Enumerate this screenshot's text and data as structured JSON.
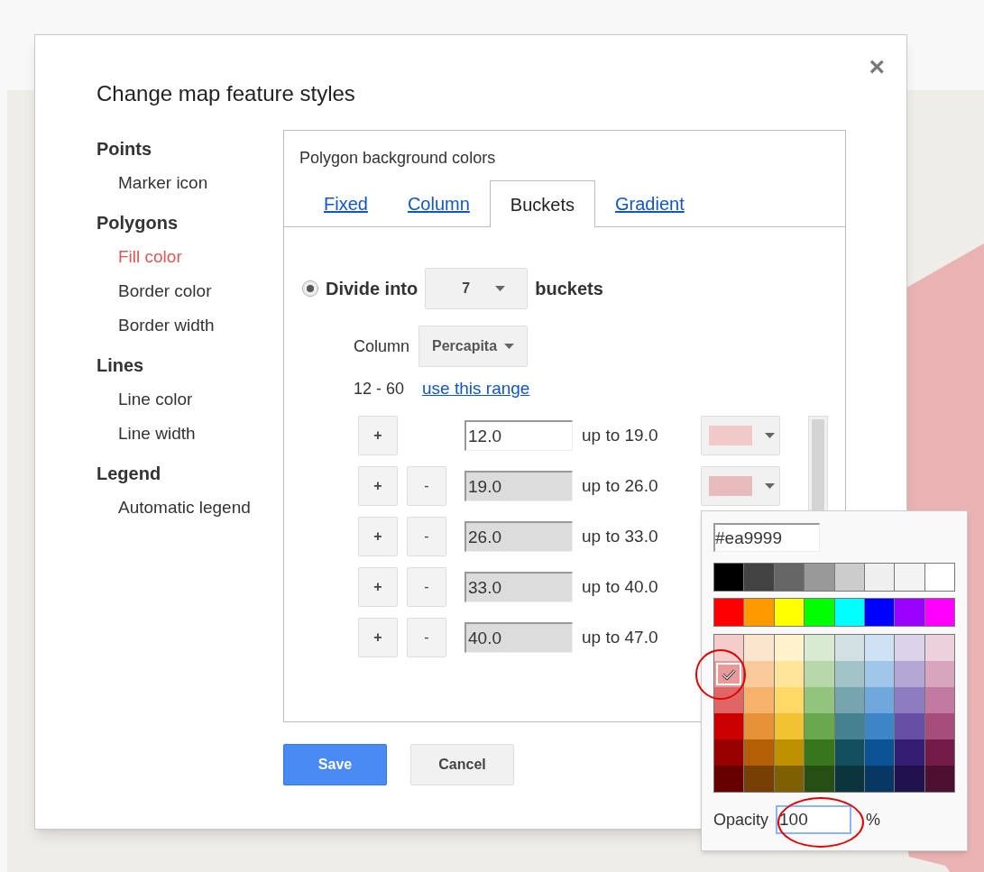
{
  "dialog": {
    "title": "Change map feature styles",
    "close": "×"
  },
  "sidebar": [
    {
      "heading": "Points",
      "items": [
        {
          "label": "Marker icon",
          "selected": false
        }
      ]
    },
    {
      "heading": "Polygons",
      "items": [
        {
          "label": "Fill color",
          "selected": true
        },
        {
          "label": "Border color",
          "selected": false
        },
        {
          "label": "Border width",
          "selected": false
        }
      ]
    },
    {
      "heading": "Lines",
      "items": [
        {
          "label": "Line color",
          "selected": false
        },
        {
          "label": "Line width",
          "selected": false
        }
      ]
    },
    {
      "heading": "Legend",
      "items": [
        {
          "label": "Automatic legend",
          "selected": false
        }
      ]
    }
  ],
  "panel": {
    "title": "Polygon background colors",
    "tabs": [
      {
        "label": "Fixed",
        "selected": false
      },
      {
        "label": "Column",
        "selected": false
      },
      {
        "label": "Buckets",
        "selected": true
      },
      {
        "label": "Gradient",
        "selected": false
      }
    ],
    "divide": {
      "selected": true,
      "label": "Divide into",
      "count": "7",
      "suffix": "buckets"
    },
    "column": {
      "label": "Column",
      "value": "Percapita"
    },
    "range": {
      "text": "12 - 60",
      "link": "use this range"
    },
    "buckets": [
      {
        "plus": "+",
        "from": "12.0",
        "disabled": false,
        "upto": "up to 19.0",
        "color": "#f2c9c9"
      },
      {
        "plus": "+",
        "minus": "-",
        "from": "19.0",
        "disabled": true,
        "upto": "up to 26.0",
        "color": "#e8bcbc"
      },
      {
        "plus": "+",
        "minus": "-",
        "from": "26.0",
        "disabled": true,
        "upto": "up to 33.0"
      },
      {
        "plus": "+",
        "minus": "-",
        "from": "33.0",
        "disabled": true,
        "upto": "up to 40.0"
      },
      {
        "plus": "+",
        "minus": "-",
        "from": "40.0",
        "disabled": true,
        "upto": "up to 47.0"
      }
    ]
  },
  "color_picker": {
    "hex": "#ea9999",
    "rows": [
      [
        {
          "color": "#000000",
          "selected": false
        },
        {
          "color": "#434343",
          "selected": false
        },
        {
          "color": "#666666",
          "selected": false
        },
        {
          "color": "#999999",
          "selected": false
        },
        {
          "color": "#cccccc",
          "selected": false
        },
        {
          "color": "#efefef",
          "selected": false
        },
        {
          "color": "#f3f3f3",
          "selected": false
        },
        {
          "color": "#ffffff",
          "selected": false
        }
      ],
      [
        {
          "color": "#ff0000",
          "selected": false
        },
        {
          "color": "#ff9900",
          "selected": false
        },
        {
          "color": "#ffff00",
          "selected": false
        },
        {
          "color": "#00ff00",
          "selected": false
        },
        {
          "color": "#00ffff",
          "selected": false
        },
        {
          "color": "#0000ff",
          "selected": false
        },
        {
          "color": "#9900ff",
          "selected": false
        },
        {
          "color": "#ff00ff",
          "selected": false
        }
      ]
    ],
    "grid": [
      [
        {
          "color": "#f4cccc",
          "selected": false
        },
        {
          "color": "#fce5cd",
          "selected": false
        },
        {
          "color": "#fff2cc",
          "selected": false
        },
        {
          "color": "#d9ead3",
          "selected": false
        },
        {
          "color": "#d0e0e3",
          "selected": false
        },
        {
          "color": "#cfe2f3",
          "selected": false
        },
        {
          "color": "#d9d2e9",
          "selected": false
        },
        {
          "color": "#ead1dc",
          "selected": false
        }
      ],
      [
        {
          "color": "#ea9999",
          "selected": true
        },
        {
          "color": "#f9cb9c",
          "selected": false
        },
        {
          "color": "#ffe599",
          "selected": false
        },
        {
          "color": "#b6d7a8",
          "selected": false
        },
        {
          "color": "#a2c4c9",
          "selected": false
        },
        {
          "color": "#9fc5e8",
          "selected": false
        },
        {
          "color": "#b4a7d6",
          "selected": false
        },
        {
          "color": "#d5a6bd",
          "selected": false
        }
      ],
      [
        {
          "color": "#e06666",
          "selected": false
        },
        {
          "color": "#f6b26b",
          "selected": false
        },
        {
          "color": "#ffd966",
          "selected": false
        },
        {
          "color": "#93c47d",
          "selected": false
        },
        {
          "color": "#76a5af",
          "selected": false
        },
        {
          "color": "#6fa8dc",
          "selected": false
        },
        {
          "color": "#8e7cc3",
          "selected": false
        },
        {
          "color": "#c27ba0",
          "selected": false
        }
      ],
      [
        {
          "color": "#cc0000",
          "selected": false
        },
        {
          "color": "#e69138",
          "selected": false
        },
        {
          "color": "#f1c232",
          "selected": false
        },
        {
          "color": "#6aa84f",
          "selected": false
        },
        {
          "color": "#45818e",
          "selected": false
        },
        {
          "color": "#3d85c6",
          "selected": false
        },
        {
          "color": "#674ea7",
          "selected": false
        },
        {
          "color": "#a64d79",
          "selected": false
        }
      ],
      [
        {
          "color": "#990000",
          "selected": false
        },
        {
          "color": "#b45f06",
          "selected": false
        },
        {
          "color": "#bf9000",
          "selected": false
        },
        {
          "color": "#38761d",
          "selected": false
        },
        {
          "color": "#134f5c",
          "selected": false
        },
        {
          "color": "#0b5394",
          "selected": false
        },
        {
          "color": "#351c75",
          "selected": false
        },
        {
          "color": "#741b47",
          "selected": false
        }
      ],
      [
        {
          "color": "#660000",
          "selected": false
        },
        {
          "color": "#783f04",
          "selected": false
        },
        {
          "color": "#7f6000",
          "selected": false
        },
        {
          "color": "#274e13",
          "selected": false
        },
        {
          "color": "#0c343d",
          "selected": false
        },
        {
          "color": "#073763",
          "selected": false
        },
        {
          "color": "#20124d",
          "selected": false
        },
        {
          "color": "#4c1130",
          "selected": false
        }
      ]
    ],
    "opacity": {
      "label": "Opacity",
      "value": "100",
      "unit": "%"
    }
  },
  "buttons": [
    {
      "label": "Save",
      "kind": "primary"
    },
    {
      "label": "Cancel",
      "kind": "secondary"
    }
  ]
}
